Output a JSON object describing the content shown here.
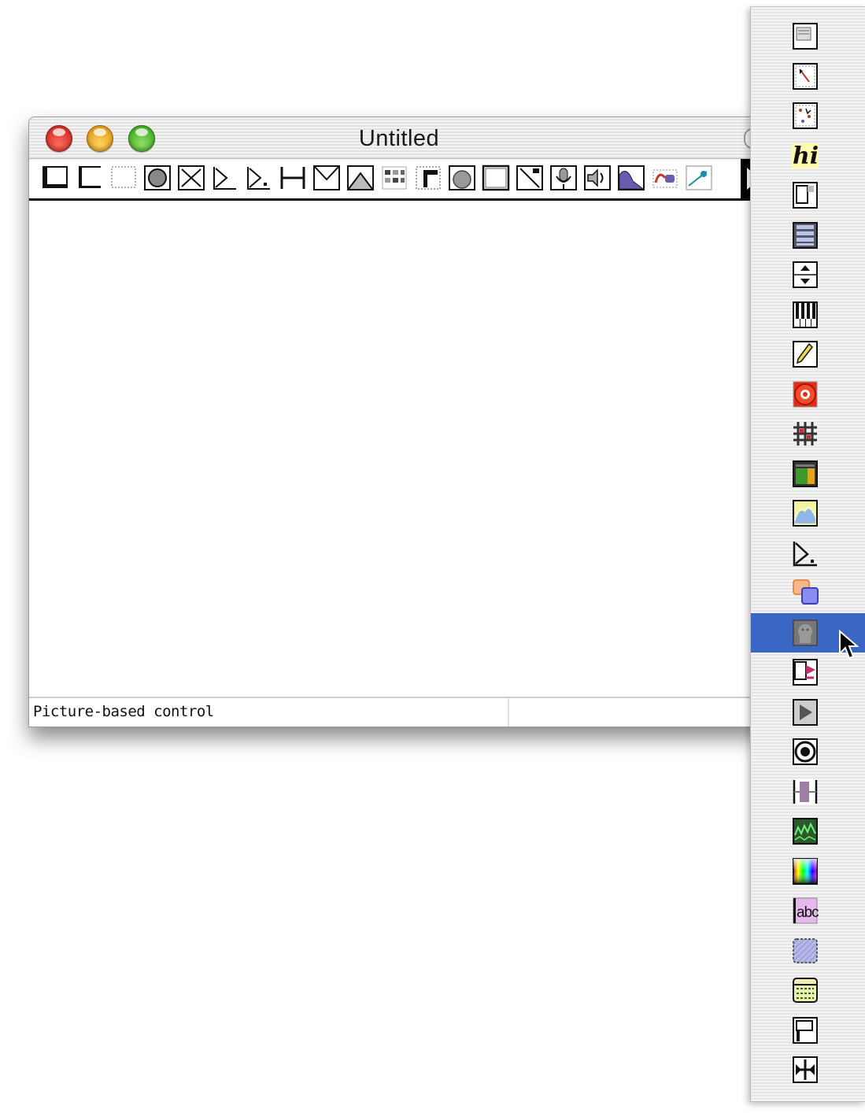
{
  "window": {
    "title": "Untitled",
    "status_text": "Picture-based control"
  },
  "toolbar": {
    "tools": [
      {
        "icon": "message-box-icon"
      },
      {
        "icon": "comment-box-icon"
      },
      {
        "icon": "empty-object-icon"
      },
      {
        "icon": "bang-button-icon"
      },
      {
        "icon": "toggle-icon"
      },
      {
        "icon": "int-number-icon"
      },
      {
        "icon": "float-number-icon"
      },
      {
        "icon": "slider-icon"
      },
      {
        "icon": "inlet-icon"
      },
      {
        "icon": "outlet-icon"
      },
      {
        "icon": "matrix-icon"
      },
      {
        "icon": "menu-icon"
      },
      {
        "icon": "dial-icon"
      },
      {
        "icon": "panel-icon"
      },
      {
        "icon": "rslider-icon"
      },
      {
        "icon": "microphone-icon"
      },
      {
        "icon": "speaker-icon"
      },
      {
        "icon": "filter-graph-icon"
      },
      {
        "icon": "function-icon"
      },
      {
        "icon": "scope-icon"
      }
    ],
    "more_icon": "right-arrow-icon"
  },
  "palette": {
    "selected_index": 15,
    "items": [
      {
        "icon": "textedit-icon"
      },
      {
        "icon": "pictslider-icon"
      },
      {
        "icon": "pictctrl-scatter-icon"
      },
      {
        "icon": "hint-icon",
        "text": "hi"
      },
      {
        "icon": "bpatcher-icon"
      },
      {
        "icon": "multislider-icon"
      },
      {
        "icon": "updown-icon"
      },
      {
        "icon": "kslider-icon"
      },
      {
        "icon": "lcd-icon"
      },
      {
        "icon": "led-icon"
      },
      {
        "icon": "matrixctrl-icon"
      },
      {
        "icon": "meter-icon"
      },
      {
        "icon": "nodes-icon"
      },
      {
        "icon": "number-box-icon"
      },
      {
        "icon": "overlay-icon"
      },
      {
        "icon": "pictctrl-icon"
      },
      {
        "icon": "playbar-icon"
      },
      {
        "icon": "play-button-icon"
      },
      {
        "icon": "radiogroup-icon"
      },
      {
        "icon": "rangeslider-icon"
      },
      {
        "icon": "spectroscope-icon"
      },
      {
        "icon": "swatch-icon"
      },
      {
        "icon": "textbox-icon",
        "text": "abc"
      },
      {
        "icon": "panel-hatched-icon"
      },
      {
        "icon": "tab-icon"
      },
      {
        "icon": "thispatcher-icon"
      },
      {
        "icon": "ubumenu-icon"
      }
    ]
  },
  "colors": {
    "selection": "#3a66c4",
    "close": "#e0392e",
    "minimize": "#f5a623",
    "zoom": "#4cbb2a"
  }
}
